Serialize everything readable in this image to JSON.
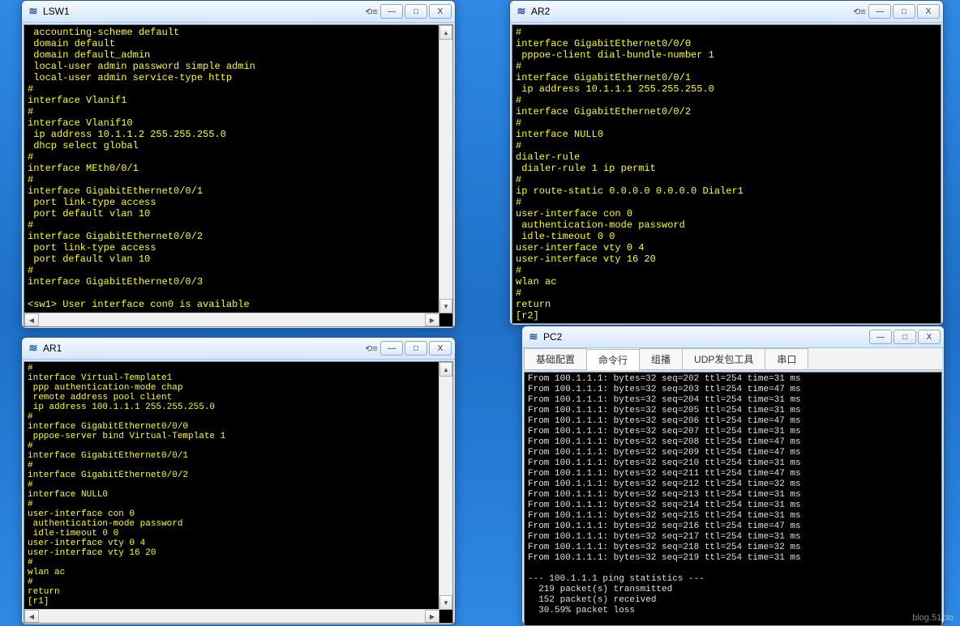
{
  "windows": {
    "lsw1": {
      "title": "LSW1",
      "lines": [
        " accounting-scheme default",
        " domain default",
        " domain default_admin",
        " local-user admin password simple admin",
        " local-user admin service-type http",
        "#",
        "interface Vlanif1",
        "#",
        "interface Vlanif10",
        " ip address 10.1.1.2 255.255.255.0",
        " dhcp select global",
        "#",
        "interface MEth0/0/1",
        "#",
        "interface GigabitEthernet0/0/1",
        " port link-type access",
        " port default vlan 10",
        "#",
        "interface GigabitEthernet0/0/2",
        " port link-type access",
        " port default vlan 10",
        "#",
        "interface GigabitEthernet0/0/3",
        "",
        "<sw1> User interface con0 is available"
      ]
    },
    "ar2": {
      "title": "AR2",
      "lines": [
        "#",
        "interface GigabitEthernet0/0/0",
        " pppoe-client dial-bundle-number 1",
        "#",
        "interface GigabitEthernet0/0/1",
        " ip address 10.1.1.1 255.255.255.0",
        "#",
        "interface GigabitEthernet0/0/2",
        "#",
        "interface NULL0",
        "#",
        "dialer-rule",
        " dialer-rule 1 ip permit",
        "#",
        "ip route-static 0.0.0.0 0.0.0.0 Dialer1",
        "#",
        "user-interface con 0",
        " authentication-mode password",
        " idle-timeout 0 0",
        "user-interface vty 0 4",
        "user-interface vty 16 20",
        "#",
        "wlan ac",
        "#",
        "return",
        "[r2]"
      ]
    },
    "ar1": {
      "title": "AR1",
      "lines": [
        "#",
        "interface Virtual-Template1",
        " ppp authentication-mode chap",
        " remote address pool client",
        " ip address 100.1.1.1 255.255.255.0",
        "#",
        "interface GigabitEthernet0/0/0",
        " pppoe-server bind Virtual-Template 1",
        "#",
        "interface GigabitEthernet0/0/1",
        "#",
        "interface GigabitEthernet0/0/2",
        "#",
        "interface NULL0",
        "#",
        "user-interface con 0",
        " authentication-mode password",
        " idle-timeout 0 0",
        "user-interface vty 0 4",
        "user-interface vty 16 20",
        "#",
        "wlan ac",
        "#",
        "return",
        "[r1]"
      ]
    },
    "pc2": {
      "title": "PC2",
      "tabs": [
        "基础配置",
        "命令行",
        "组播",
        "UDP发包工具",
        "串口"
      ],
      "active_tab": 1,
      "lines": [
        "From 100.1.1.1: bytes=32 seq=202 ttl=254 time=31 ms",
        "From 100.1.1.1: bytes=32 seq=203 ttl=254 time=47 ms",
        "From 100.1.1.1: bytes=32 seq=204 ttl=254 time=31 ms",
        "From 100.1.1.1: bytes=32 seq=205 ttl=254 time=31 ms",
        "From 100.1.1.1: bytes=32 seq=206 ttl=254 time=47 ms",
        "From 100.1.1.1: bytes=32 seq=207 ttl=254 time=31 ms",
        "From 100.1.1.1: bytes=32 seq=208 ttl=254 time=47 ms",
        "From 100.1.1.1: bytes=32 seq=209 ttl=254 time=47 ms",
        "From 100.1.1.1: bytes=32 seq=210 ttl=254 time=31 ms",
        "From 100.1.1.1: bytes=32 seq=211 ttl=254 time=47 ms",
        "From 100.1.1.1: bytes=32 seq=212 ttl=254 time=32 ms",
        "From 100.1.1.1: bytes=32 seq=213 ttl=254 time=31 ms",
        "From 100.1.1.1: bytes=32 seq=214 ttl=254 time=31 ms",
        "From 100.1.1.1: bytes=32 seq=215 ttl=254 time=31 ms",
        "From 100.1.1.1: bytes=32 seq=216 ttl=254 time=47 ms",
        "From 100.1.1.1: bytes=32 seq=217 ttl=254 time=31 ms",
        "From 100.1.1.1: bytes=32 seq=218 ttl=254 time=32 ms",
        "From 100.1.1.1: bytes=32 seq=219 ttl=254 time=31 ms",
        "",
        "--- 100.1.1.1 ping statistics ---",
        "  219 packet(s) transmitted",
        "  152 packet(s) received",
        "  30.59% packet loss"
      ]
    }
  },
  "btns": {
    "min": "—",
    "max": "□",
    "close": "X",
    "reset": "⟲≡"
  },
  "watermark": "blog.51cto"
}
